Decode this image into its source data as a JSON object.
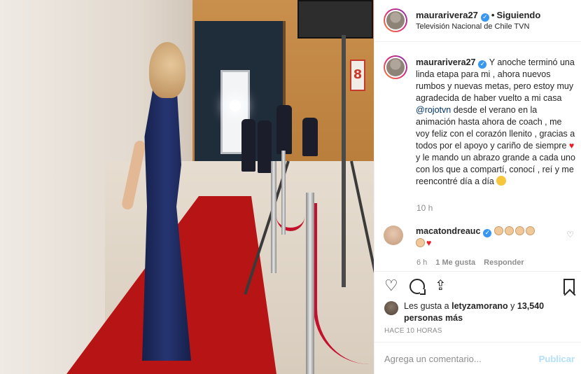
{
  "post": {
    "header": {
      "username": "maurarivera27",
      "follow_status": "Siguiendo",
      "location": "Televisión Nacional de Chile TVN"
    },
    "photo": {
      "sign_number": "8"
    },
    "caption": {
      "username": "maurarivera27",
      "text_part1": "Y anoche terminó una linda etapa para mi , ahora nuevos rumbos y nuevas metas, pero estoy muy agradecida de haber vuelto a mi casa ",
      "mention": "@rojotvn",
      "text_part2": " desde el verano en la animación hasta ahora de coach , me voy feliz con el corazón llenito , gracias a todos por el apoyo y cariño de siempre ",
      "text_part3": " y le mando un abrazo grande a cada uno con los que a compartí, conocí , reí y me reencontré día a día ",
      "time": "10 h"
    },
    "comment": {
      "username": "macatondreauc",
      "time": "6 h",
      "likes": "1 Me gusta",
      "reply": "Responder"
    },
    "likes": {
      "prefix": "Les gusta a ",
      "user": "letyzamorano",
      "middle": " y ",
      "count": "13,540 personas más"
    },
    "posted_ago": "HACE 10 HORAS",
    "add_comment": {
      "placeholder": "Agrega un comentario...",
      "post_label": "Publicar"
    }
  },
  "colors": {
    "verified": "#3897f0",
    "mention": "#003569",
    "publish_disabled": "#b2dffc",
    "carpet": "#b71515",
    "dress": "#263573"
  },
  "icons": [
    "verified-icon",
    "heart-icon",
    "comment-icon",
    "share-icon",
    "save-icon",
    "small-heart-icon",
    "heart-emoji",
    "clap-emoji",
    "face-emoji"
  ]
}
